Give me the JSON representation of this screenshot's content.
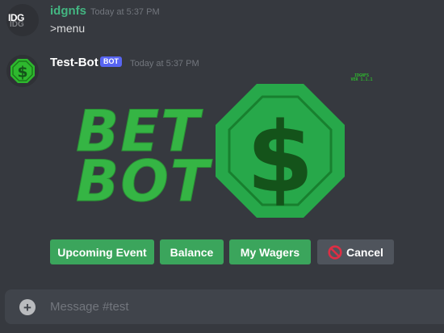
{
  "messages": [
    {
      "author": "idgnfs",
      "author_color": "#43b581",
      "timestamp": "Today at 5:37 PM",
      "content": ">menu",
      "avatar_text": "IDG"
    },
    {
      "author": "Test-Bot",
      "author_color": "#ffffff",
      "badge": "BOT",
      "timestamp": "Today at 5:37 PM",
      "avatar_icon": "dollar-octagon-icon",
      "image": {
        "line1": "BET",
        "line2": "BOT",
        "symbol": "$",
        "corner_text_1": "IDGNFS",
        "corner_text_2": "VER 1.1.1",
        "color": "#2eb82e"
      }
    }
  ],
  "buttons": [
    {
      "label": "Upcoming Event",
      "style": "success"
    },
    {
      "label": "Balance",
      "style": "success"
    },
    {
      "label": "My Wagers",
      "style": "success"
    },
    {
      "label": "Cancel",
      "style": "secondary",
      "icon": "no-entry-icon"
    }
  ],
  "composer": {
    "placeholder": "Message #test",
    "icon": "plus-circle-icon"
  }
}
